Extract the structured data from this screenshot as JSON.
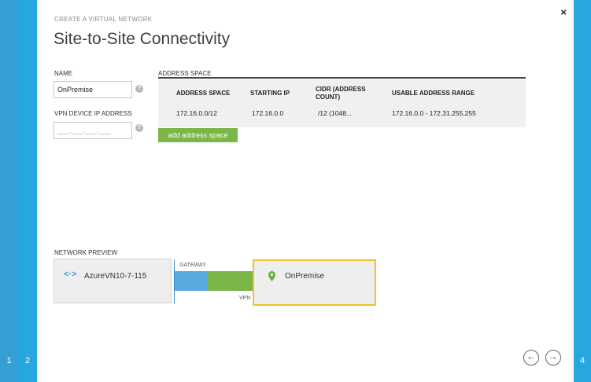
{
  "wizard": {
    "kicker": "CREATE A VIRTUAL NETWORK",
    "title": "Site-to-Site Connectivity",
    "steps": [
      "1",
      "2",
      "4"
    ],
    "close_label": "×"
  },
  "form": {
    "name_label": "NAME",
    "name_value": "OnPremise",
    "vpn_ip_label": "VPN DEVICE IP ADDRESS",
    "vpn_ip_placeholder": "___.___.___.___",
    "help_glyph": "?"
  },
  "address_space": {
    "section_label": "ADDRESS SPACE",
    "columns": [
      "ADDRESS SPACE",
      "STARTING IP",
      "CIDR (ADDRESS COUNT)",
      "USABLE ADDRESS RANGE"
    ],
    "rows": [
      {
        "address_space": "172.16.0.0/12",
        "starting_ip": "172.16.0.0",
        "cidr": "/12 (1048...",
        "usable_range": "172.16.0.0 - 172.31.255.255"
      }
    ],
    "add_button_label": "add address space"
  },
  "preview": {
    "section_label": "NETWORK PREVIEW",
    "vnet_name": "AzureVN10-7-115",
    "gateway_label": "GATEWAY",
    "vpn_label": "VPN",
    "local_name": "OnPremise",
    "colors": {
      "gateway": "#5aa8e0",
      "vpn": "#7ab648",
      "selected_border": "#f0c22d"
    }
  },
  "nav": {
    "back_glyph": "←",
    "next_glyph": "→"
  }
}
